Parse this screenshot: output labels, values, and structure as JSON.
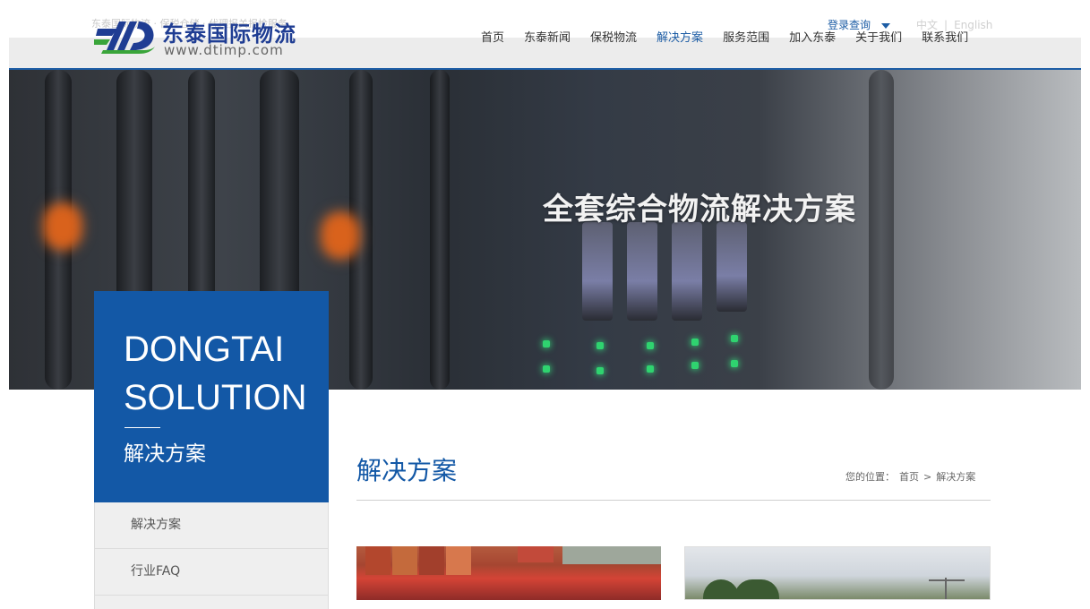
{
  "header": {
    "tagline": "东泰国际物流 · 保税仓储 · 代理报关报检服务",
    "logo_cn": "东泰国际物流",
    "logo_url": "www.dtimp.com",
    "login": "登录查询",
    "lang_cn": "中文",
    "lang_sep": "|",
    "lang_en": "English",
    "nav": [
      {
        "label": "首页"
      },
      {
        "label": "东泰新闻"
      },
      {
        "label": "保税物流"
      },
      {
        "label": "解决方案"
      },
      {
        "label": "服务范围"
      },
      {
        "label": "加入东泰"
      },
      {
        "label": "关于我们"
      },
      {
        "label": "联系我们"
      }
    ],
    "active_nav": "解决方案"
  },
  "banner": {
    "title": "全套综合物流解决方案"
  },
  "side": {
    "en_line1": "DONGTAI",
    "en_line2": "SOLUTION",
    "cn": "解决方案",
    "menu": [
      {
        "label": "解决方案"
      },
      {
        "label": "行业FAQ"
      }
    ]
  },
  "main": {
    "title": "解决方案",
    "breadcrumb": {
      "prefix": "您的位置：",
      "home": "首页",
      "sep": ">",
      "current": "解决方案"
    }
  },
  "colors": {
    "brand_blue": "#1358a6",
    "nav_active": "#1d5da5",
    "side_menu_bg": "#efefef"
  },
  "icons": {
    "logo": "dt-logo-icon",
    "login_caret": "caret-down-icon"
  }
}
